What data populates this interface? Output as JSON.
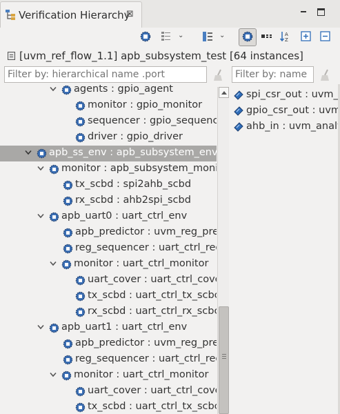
{
  "tab": {
    "title": "Verification Hierarchy",
    "close": "⊠"
  },
  "summary": "[uvm_ref_flow_1.1] apb_subsystem_test [64 instances]",
  "filters": {
    "left_placeholder": "Filter by: hierarchical name .port",
    "right_placeholder": "Filter by: name"
  },
  "toolbar": {
    "buttons": [
      "component-icon",
      "layout-list-icon",
      "layout-columns-icon",
      "show-ports-icon",
      "connections-icon",
      "sort-az-icon",
      "expand-all-icon",
      "collapse-all-icon"
    ]
  },
  "tree": [
    {
      "depth": 3,
      "expanded": true,
      "label": "agents : gpio_agent"
    },
    {
      "depth": 4,
      "leaf": true,
      "label": "monitor : gpio_monitor"
    },
    {
      "depth": 4,
      "leaf": true,
      "label": "sequencer : gpio_sequencer"
    },
    {
      "depth": 4,
      "leaf": true,
      "label": "driver : gpio_driver"
    },
    {
      "depth": 1,
      "expanded": true,
      "selected": true,
      "label": "apb_ss_env : apb_subsystem_env"
    },
    {
      "depth": 2,
      "expanded": true,
      "label": "monitor : apb_subsystem_moni"
    },
    {
      "depth": 3,
      "leaf": true,
      "label": "tx_scbd : spi2ahb_scbd"
    },
    {
      "depth": 3,
      "leaf": true,
      "label": "rx_scbd : ahb2spi_scbd"
    },
    {
      "depth": 2,
      "expanded": true,
      "label": "apb_uart0 : uart_ctrl_env"
    },
    {
      "depth": 3,
      "leaf": true,
      "label": "apb_predictor : uvm_reg_pre"
    },
    {
      "depth": 3,
      "leaf": true,
      "label": "reg_sequencer : uart_ctrl_reg"
    },
    {
      "depth": 3,
      "expanded": true,
      "label": "monitor : uart_ctrl_monitor"
    },
    {
      "depth": 4,
      "leaf": true,
      "label": "uart_cover : uart_ctrl_cove"
    },
    {
      "depth": 4,
      "leaf": true,
      "label": "tx_scbd : uart_ctrl_tx_scbc"
    },
    {
      "depth": 4,
      "leaf": true,
      "label": "rx_scbd : uart_ctrl_rx_scbc"
    },
    {
      "depth": 2,
      "expanded": true,
      "label": "apb_uart1 : uart_ctrl_env"
    },
    {
      "depth": 3,
      "leaf": true,
      "label": "apb_predictor : uvm_reg_pre"
    },
    {
      "depth": 3,
      "leaf": true,
      "label": "reg_sequencer : uart_ctrl_reg"
    },
    {
      "depth": 3,
      "expanded": true,
      "label": "monitor : uart_ctrl_monitor"
    },
    {
      "depth": 4,
      "leaf": true,
      "label": "uart_cover : uart_ctrl_cove"
    },
    {
      "depth": 4,
      "leaf": true,
      "label": "tx_scbd : uart_ctrl_tx_scbc"
    }
  ],
  "ports": [
    {
      "label": "spi_csr_out : uvm_a"
    },
    {
      "label": "gpio_csr_out : uvm"
    },
    {
      "label": "ahb_in : uvm_analy"
    }
  ],
  "colors": {
    "selection": "#a9a8a6",
    "component_blue": "#3b6fb5",
    "port_blue": "#2f6db8"
  }
}
